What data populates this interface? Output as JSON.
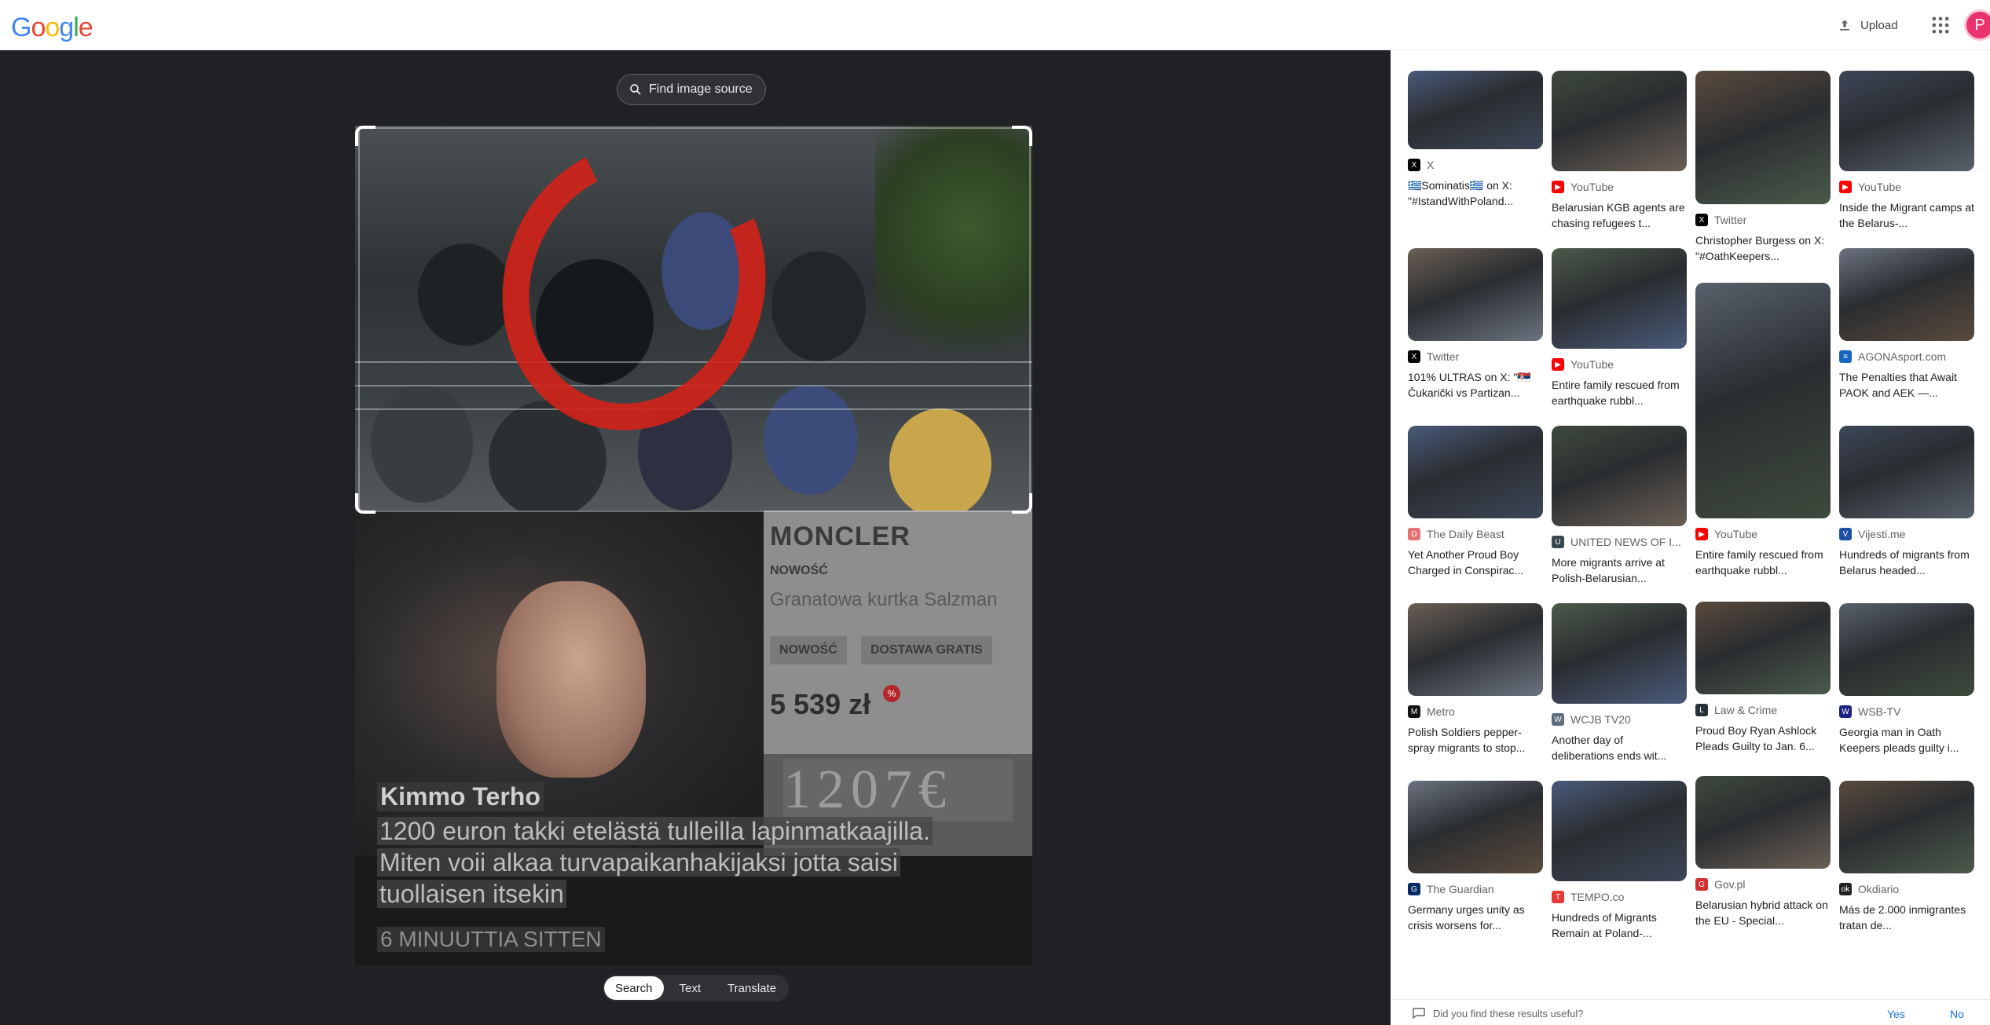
{
  "header": {
    "logo": [
      "G",
      "o",
      "o",
      "g",
      "l",
      "e"
    ],
    "logo_colors": [
      "#4285f4",
      "#ea4335",
      "#fbbc05",
      "#4285f4",
      "#34a853",
      "#ea4335"
    ],
    "upload_label": "Upload",
    "avatar_letter": "P"
  },
  "lens": {
    "find_source_label": "Find image source",
    "modes": [
      "Search",
      "Text",
      "Translate"
    ],
    "active_mode": "Search",
    "image_text": {
      "brand": "MONCLER",
      "nowosc": "NOWOŚĆ",
      "product": "Granatowa kurtka Salzman",
      "tag1": "NOWOŚĆ",
      "tag2": "DOSTAWA GRATIS",
      "price": "5 539 zł",
      "pct": "%",
      "big_price": "1207€",
      "author": "Kimmo Terho",
      "caption_line1": "1200 euron takki etelästä tulleilla lapinmatkaajilla.",
      "caption_line2": "Miten voii alkaa turvapaikanhakijaksi jotta saisi",
      "caption_line3": "tuollaisen itsekin",
      "time": "6 MINUUTTIA SITTEN"
    }
  },
  "results": [
    {
      "source": "X",
      "title": "🇬🇷Sominatis🇬🇷 on X: \"#IstandWithPoland...",
      "fav_color": "#000000",
      "fav_glyph": "X"
    },
    {
      "source": "YouTube",
      "title": "Belarusian KGB agents are chasing refugees t...",
      "fav_color": "#ff0000",
      "fav_glyph": "▶"
    },
    {
      "source": "Twitter",
      "title": "Christopher Burgess on X: \"#OathKeepers...",
      "fav_color": "#000000",
      "fav_glyph": "X"
    },
    {
      "source": "YouTube",
      "title": "Inside the Migrant camps at the Belarus-...",
      "fav_color": "#ff0000",
      "fav_glyph": "▶"
    },
    {
      "source": "Twitter",
      "title": "101% ULTRAS on X: \"🇷🇸 Čukarički vs Partizan...",
      "fav_color": "#000000",
      "fav_glyph": "X"
    },
    {
      "source": "YouTube",
      "title": "Entire family rescued from earthquake rubbl...",
      "fav_color": "#ff0000",
      "fav_glyph": "▶"
    },
    {
      "source": "YouTube",
      "title": "Entire family rescued from earthquake rubbl...",
      "fav_color": "#ff0000",
      "fav_glyph": "▶"
    },
    {
      "source": "AGONAsport.com",
      "title": "The Penalties that Await PAOK and AEK —...",
      "fav_color": "#1565c0",
      "fav_glyph": "≡"
    },
    {
      "source": "The Daily Beast",
      "title": "Yet Another Proud Boy Charged in Conspirac...",
      "fav_color": "#e57373",
      "fav_glyph": "D"
    },
    {
      "source": "UNITED NEWS OF I...",
      "title": "More migrants arrive at Polish-Belarusian...",
      "fav_color": "#37474f",
      "fav_glyph": "U"
    },
    {
      "source": "Law & Crime",
      "title": "Proud Boy Ryan Ashlock Pleads Guilty to Jan. 6...",
      "fav_color": "#263238",
      "fav_glyph": "L"
    },
    {
      "source": "Vijesti.me",
      "title": "Hundreds of migrants from Belarus headed...",
      "fav_color": "#1e4fa8",
      "fav_glyph": "V"
    },
    {
      "source": "Metro",
      "title": "Polish Soldiers pepper-spray migrants to stop...",
      "fav_color": "#111111",
      "fav_glyph": "M"
    },
    {
      "source": "WCJB TV20",
      "title": "Another day of deliberations ends wit...",
      "fav_color": "#5d6d7e",
      "fav_glyph": "W"
    },
    {
      "source": "WSB-TV",
      "title": "Georgia man in Oath Keepers pleads guilty i...",
      "fav_color": "#1a237e",
      "fav_glyph": "W"
    },
    {
      "source": "The Guardian",
      "title": "Germany urges unity as crisis worsens for...",
      "fav_color": "#052962",
      "fav_glyph": "G"
    },
    {
      "source": "TEMPO.co",
      "title": "Hundreds of Migrants Remain at Poland-...",
      "fav_color": "#e53935",
      "fav_glyph": "T"
    },
    {
      "source": "Gov.pl",
      "title": "Belarusian hybrid attack on the EU - Special...",
      "fav_color": "#d32f2f",
      "fav_glyph": "G"
    },
    {
      "source": "Okdiario",
      "title": "Más de 2.000 inmigrantes tratan de...",
      "fav_color": "#222222",
      "fav_glyph": "ok"
    }
  ],
  "feedback": {
    "question": "Did you find these results useful?",
    "yes": "Yes",
    "no": "No"
  }
}
